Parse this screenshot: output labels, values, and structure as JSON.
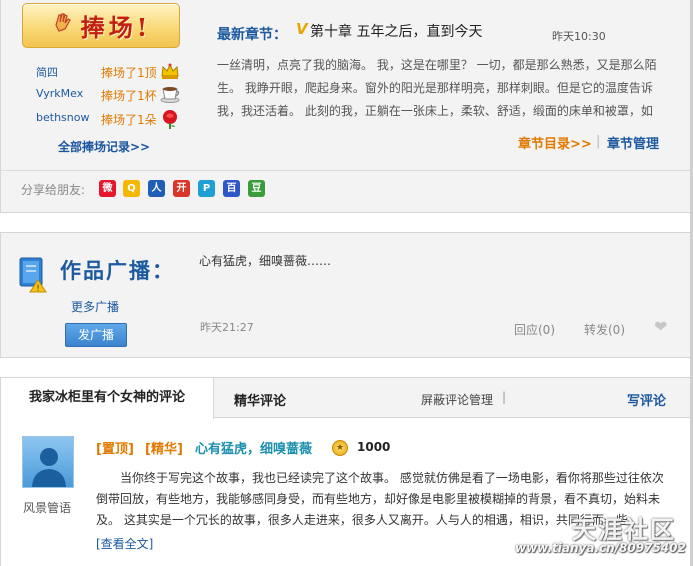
{
  "bang": {
    "button_label": "捧场!",
    "supporters": [
      {
        "name": "简四",
        "action": "捧场了1顶",
        "gift": "crown-icon"
      },
      {
        "name": "VyrkMex",
        "action": "捧场了1杯",
        "gift": "coffee-cup-icon"
      },
      {
        "name": "bethsnow",
        "action": "捧场了1朵",
        "gift": "rose-icon"
      }
    ],
    "all_records": "全部捧场记录>>"
  },
  "latest": {
    "label": "最新章节：",
    "vip_mark": "V",
    "chapter_title": "第十章  五年之后，直到今天",
    "time": "昨天10:30",
    "excerpt": "一丝清明，点亮了我的脑海。 我，这是在哪里？ 一切，都是那么熟悉，又是那么陌生。 我睁开眼，爬起身来。窗外的阳光是那样明亮，那样刺眼。但是它的温度告诉我，我还活着。 此刻的我，正躺在一张床上，柔软、舒适，缎面的床单和被罩，如",
    "chapter_list": "章节目录>>",
    "separator": "|",
    "chapter_manage": "章节管理"
  },
  "share": {
    "label": "分享给朋友:",
    "icons": [
      {
        "name": "weibo-icon",
        "glyph": "微",
        "color": "#e6162d"
      },
      {
        "name": "qzone-icon",
        "glyph": "Q",
        "color": "#f5b800"
      },
      {
        "name": "renren-icon",
        "glyph": "人",
        "color": "#1f5fb5"
      },
      {
        "name": "kaixin-icon",
        "glyph": "开",
        "color": "#d9362a"
      },
      {
        "name": "tianya-icon",
        "glyph": "P",
        "color": "#1e9fd6"
      },
      {
        "name": "baidu-icon",
        "glyph": "百",
        "color": "#2f56c9"
      },
      {
        "name": "douban-icon",
        "glyph": "豆",
        "color": "#3c9b3a"
      }
    ]
  },
  "broadcast": {
    "title": "作品广播：",
    "message": "心有猛虎，细嗅蔷薇……",
    "more": "更多广播",
    "post_button": "发广播",
    "time": "昨天21:27",
    "reply": "回应(0)",
    "repost": "转发(0)"
  },
  "comments": {
    "tab_main": "我家冰柜里有个女神的评论",
    "tab_essence": "精华评论",
    "shield_manage": "屏蔽评论管理",
    "separator": "|",
    "write": "写评论",
    "item": {
      "username": "风景管语",
      "pinned": "[置顶]",
      "essence": "[精华]",
      "title": "心有猛虎，细嗅蔷薇",
      "score": "1000",
      "body": "当你终于写完这个故事，我也已经读完了这个故事。 感觉就仿佛是看了一场电影，看你将那些过往依次倒带回放，有些地方，我能够感同身受，而有些地方，却好像是电影里被模糊掉的背景，看不真切，始料未及。 这其实是一个冗长的故事，很多人走进来，很多人又离开。人与人的相遇，相识，共同行而一些",
      "more": "[查看全文]"
    }
  },
  "watermark": {
    "logo": "天涯社区",
    "url": "www.tianya.cn/80975402"
  }
}
